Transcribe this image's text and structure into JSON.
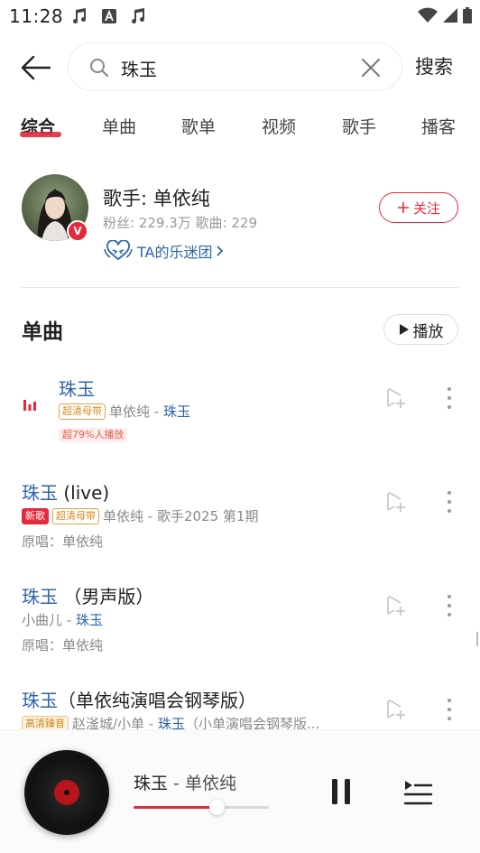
{
  "status_bar": {
    "time": "11:28",
    "icons": [
      "music-note-icon",
      "a-badge-icon",
      "music-note-icon",
      "wifi-icon",
      "signal-icon",
      "battery-icon"
    ]
  },
  "search": {
    "query": "珠玉",
    "action_label": "搜索"
  },
  "tabs": [
    {
      "label": "综合",
      "active": true
    },
    {
      "label": "单曲",
      "active": false
    },
    {
      "label": "歌单",
      "active": false
    },
    {
      "label": "视频",
      "active": false
    },
    {
      "label": "歌手",
      "active": false
    },
    {
      "label": "播客",
      "active": false
    }
  ],
  "artist": {
    "name": "歌手: 单依纯",
    "stats": "粉丝: 229.3万 歌曲: 229",
    "fan_club": "TA的乐迷团",
    "badge": "V",
    "follow_label": "关注"
  },
  "songs_section": {
    "title": "单曲",
    "play_label": "播放"
  },
  "songs": [
    {
      "title": "珠玉",
      "suffix": "",
      "playing": true,
      "tags": [
        "超清母带"
      ],
      "artist": "单依纯",
      "separator": " - ",
      "album": "珠玉",
      "extra": "超79%人播放"
    },
    {
      "title": "珠玉",
      "suffix": " (live)",
      "playing": false,
      "tags": [
        "新歌",
        "超清母带"
      ],
      "artist": "单依纯",
      "separator": " - ",
      "album": "歌手2025 第1期",
      "extra": "原唱：单依纯"
    },
    {
      "title": "珠玉",
      "suffix": " （男声版）",
      "playing": false,
      "tags": [],
      "artist": "小曲儿",
      "separator": " - ",
      "album": "珠玉",
      "extra": "原唱：单依纯"
    },
    {
      "title": "珠玉",
      "suffix": "（单依纯演唱会钢琴版）",
      "playing": false,
      "tags": [
        "高清臻音"
      ],
      "artist": "赵滏城/小单",
      "separator": " - ",
      "album": "珠玉",
      "album_suffix": "（小单演唱会钢琴版...",
      "extra": ""
    }
  ],
  "player": {
    "title": "珠玉",
    "separator": " - ",
    "artist": "单依纯",
    "progress": 0.61
  },
  "colors": {
    "accent": "#e4293c",
    "link": "#2e64a8",
    "muted": "#888888"
  }
}
